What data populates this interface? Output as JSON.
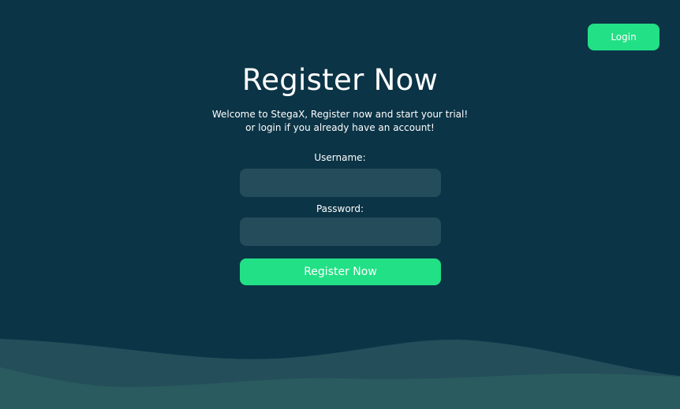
{
  "header": {
    "login_label": "Login"
  },
  "main": {
    "title": "Register Now",
    "subtitle_line1": "Welcome to StegaX, Register now and start your trial!",
    "subtitle_line2": "or login if you already have an account!"
  },
  "form": {
    "username_label": "Username:",
    "username_value": "",
    "password_label": "Password:",
    "password_value": "",
    "submit_label": "Register Now"
  },
  "colors": {
    "background": "#0b3446",
    "accent": "#22e085",
    "input_background": "#244c5b",
    "wave_light": "#244e5a",
    "wave_dark": "#2a5b5f"
  }
}
